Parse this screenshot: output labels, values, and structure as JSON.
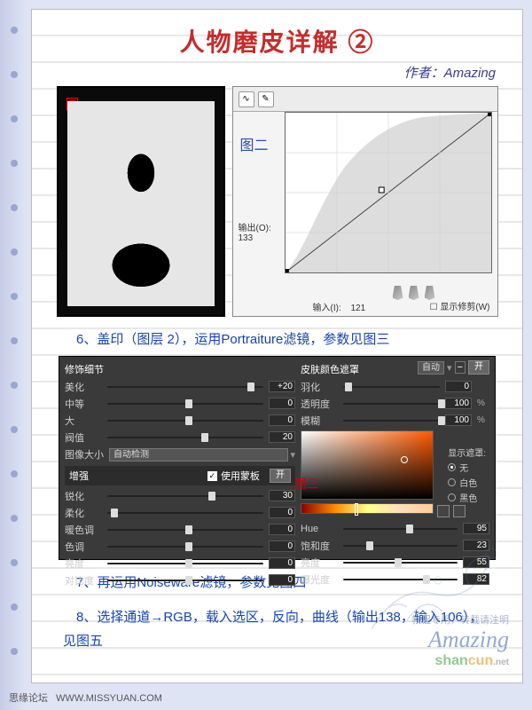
{
  "title": "人物磨皮详解 ②",
  "author_prefix": "作者：",
  "author": "Amazing",
  "fig1_label": "图一",
  "fig2_label": "图二",
  "fig3_label": "图三",
  "curves": {
    "output_label": "输出(O):",
    "output_val": "133",
    "input_label": "输入(I):",
    "input_val": "121",
    "show_clip": "显示修剪(W)"
  },
  "step6": "6、盖印（图层 2），运用Portraiture滤镜，参数见图三",
  "step7": "7、再运用Noiseware滤镜，参数见图四",
  "step8": "8、选择通道→RGB，载入选区，反向，曲线（输出138，输入106），见图五",
  "portraiture": {
    "left_title": "修饰细节",
    "rows_left1": [
      {
        "label": "美化",
        "val": "+20",
        "thumb": 90
      },
      {
        "label": "中等",
        "val": "0",
        "thumb": 50
      },
      {
        "label": "大",
        "val": "0",
        "thumb": 50
      },
      {
        "label": "阀值",
        "val": "20",
        "thumb": 60
      }
    ],
    "imgsize_label": "图像大小",
    "imgsize_val": "自动检测",
    "enhance_title": "增强",
    "use_mask": "使用蒙板",
    "btn_open": "开",
    "rows_left2": [
      {
        "label": "锐化",
        "val": "30",
        "thumb": 65
      },
      {
        "label": "柔化",
        "val": "0",
        "thumb": 2
      },
      {
        "label": "暖色调",
        "val": "0",
        "thumb": 50
      },
      {
        "label": "色调",
        "val": "0",
        "thumb": 50
      },
      {
        "label": "亮度",
        "val": "0",
        "thumb": 50
      },
      {
        "label": "对比度",
        "val": "0",
        "thumb": 50
      }
    ],
    "right_title": "皮肤颜色遮罩",
    "auto": "自动",
    "rows_right1": [
      {
        "label": "羽化",
        "val": "0",
        "pct": "",
        "thumb": 2
      },
      {
        "label": "透明度",
        "val": "100",
        "pct": "%",
        "thumb": 98
      },
      {
        "label": "模糊",
        "val": "100",
        "pct": "%",
        "thumb": 98
      }
    ],
    "mask_title": "显示遮罩:",
    "mask_opts": [
      "无",
      "白色",
      "黑色"
    ],
    "rows_right2": [
      {
        "label": "Hue",
        "val": "95",
        "thumb": 55
      },
      {
        "label": "饱和度",
        "val": "23",
        "thumb": 20
      },
      {
        "label": "亮度",
        "val": "55",
        "thumb": 45
      },
      {
        "label": "曝光度",
        "val": "82",
        "thumb": 70
      }
    ]
  },
  "footer_forum": "思缘论坛",
  "footer_url": "WWW.MISSYUAN.COM",
  "wm_tip": "教程专用，转载请注明",
  "wm_brand": "Amazing",
  "wm_site_1": "shan",
  "wm_site_2": "cun",
  "wm_site_3": ".net"
}
